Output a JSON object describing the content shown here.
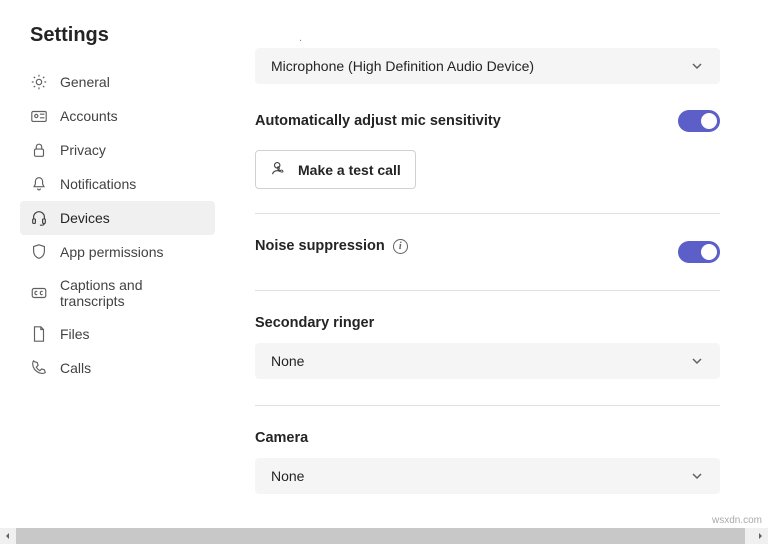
{
  "title": "Settings",
  "sidebar": {
    "items": [
      {
        "label": "General"
      },
      {
        "label": "Accounts"
      },
      {
        "label": "Privacy"
      },
      {
        "label": "Notifications"
      },
      {
        "label": "Devices"
      },
      {
        "label": "App permissions"
      },
      {
        "label": "Captions and transcripts"
      },
      {
        "label": "Files"
      },
      {
        "label": "Calls"
      }
    ]
  },
  "main": {
    "microphone": {
      "selected": "Microphone (High Definition Audio Device)"
    },
    "autoMic": {
      "label": "Automatically adjust mic sensitivity",
      "on": true
    },
    "testCall": {
      "label": "Make a test call"
    },
    "noise": {
      "label": "Noise suppression",
      "on": true
    },
    "ringer": {
      "label": "Secondary ringer",
      "selected": "None"
    },
    "camera": {
      "label": "Camera",
      "selected": "None"
    }
  },
  "watermark": "wsxdn.com"
}
